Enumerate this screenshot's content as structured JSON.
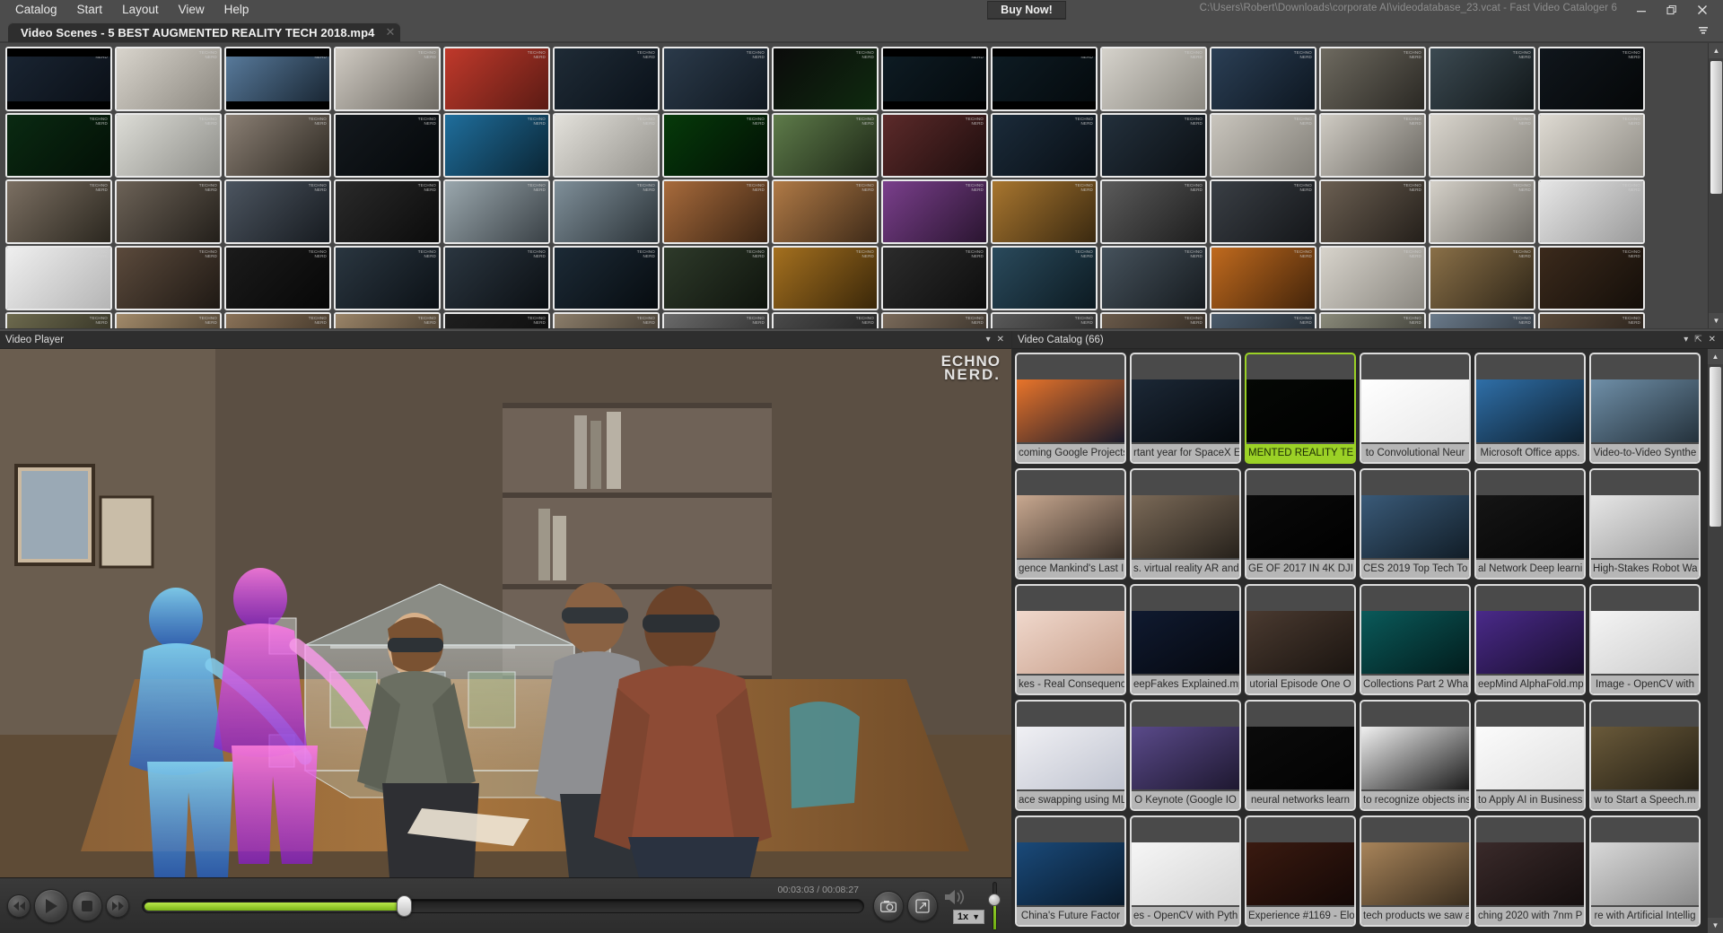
{
  "window": {
    "title_path": "C:\\Users\\Robert\\Downloads\\corporate AI\\videodatabase_23.vcat - Fast Video Cataloger 6",
    "minimize_label": "Minimize",
    "restore_label": "Restore",
    "close_label": "Close",
    "accent_color": "#9bd126",
    "chrome_color": "#4c4c4c"
  },
  "menu": {
    "items": [
      {
        "label": "Catalog"
      },
      {
        "label": "Start"
      },
      {
        "label": "Layout"
      },
      {
        "label": "View"
      },
      {
        "label": "Help"
      }
    ]
  },
  "buy_now": {
    "label": "Buy Now!"
  },
  "tabs": {
    "active": "Video Scenes - 5 BEST AUGMENTED REALITY TECH 2018.mp4",
    "close_label": "✕",
    "menu_label": "≡"
  },
  "scenes_panel": {
    "name": "Video Scenes",
    "scroll_up": "▲",
    "scroll_down": "▼",
    "watermark": "TECHNO\nNERD",
    "thumbs": [
      {
        "c1": "#1a2533",
        "c2": "#0a0f16",
        "bars": true
      },
      {
        "c1": "#d8d4cc",
        "c2": "#8c8880",
        "bars": false
      },
      {
        "c1": "#5b7ea0",
        "c2": "#16222e",
        "bars": true
      },
      {
        "c1": "#cfcac2",
        "c2": "#6e6a63",
        "bars": false
      },
      {
        "c1": "#c0392b",
        "c2": "#5b1b14",
        "bars": false
      },
      {
        "c1": "#1f2b36",
        "c2": "#0a1119",
        "bars": false
      },
      {
        "c1": "#2b3a4a",
        "c2": "#101820",
        "bars": false
      },
      {
        "c1": "#0b0b0b",
        "c2": "#0f2a0f",
        "bars": false
      },
      {
        "c1": "#0e1c24",
        "c2": "#04090c",
        "bars": true
      },
      {
        "c1": "#0e1c24",
        "c2": "#04090c",
        "bars": true
      },
      {
        "c1": "#d5d2cb",
        "c2": "#8b8880",
        "bars": false
      },
      {
        "c1": "#2b3f55",
        "c2": "#0d1620",
        "bars": false
      },
      {
        "c1": "#6e6a60",
        "c2": "#2a2823",
        "bars": false
      },
      {
        "c1": "#3c4a52",
        "c2": "#111719",
        "bars": false
      },
      {
        "c1": "#10161c",
        "c2": "#050708",
        "bars": false
      },
      {
        "c1": "#0a2a12",
        "c2": "#031006",
        "bars": false
      },
      {
        "c1": "#dcdcd6",
        "c2": "#8f8f8a",
        "bars": false
      },
      {
        "c1": "#8a7f74",
        "c2": "#2e2922",
        "bars": false
      },
      {
        "c1": "#14191e",
        "c2": "#05080a",
        "bars": false
      },
      {
        "c1": "#1f6e9c",
        "c2": "#0a2534",
        "bars": false
      },
      {
        "c1": "#e3e1db",
        "c2": "#95938d",
        "bars": false
      },
      {
        "c1": "#063a0a",
        "c2": "#021004",
        "bars": false
      },
      {
        "c1": "#5e7b4a",
        "c2": "#1d2716",
        "bars": false
      },
      {
        "c1": "#5c2a2a",
        "c2": "#1d0d0d",
        "bars": false
      },
      {
        "c1": "#1b2b3a",
        "c2": "#080e14",
        "bars": false
      },
      {
        "c1": "#23303c",
        "c2": "#0b0f13",
        "bars": false
      },
      {
        "c1": "#c9c5bd",
        "c2": "#827f78",
        "bars": false
      },
      {
        "c1": "#cfcbc3",
        "c2": "#6b6862",
        "bars": false
      },
      {
        "c1": "#d9d5cd",
        "c2": "#8b8881",
        "bars": false
      },
      {
        "c1": "#dedad2",
        "c2": "#918e87",
        "bars": false
      },
      {
        "c1": "#7b6f62",
        "c2": "#2b271f",
        "bars": false
      },
      {
        "c1": "#6c6257",
        "c2": "#231f1a",
        "bars": false
      },
      {
        "c1": "#4c5560",
        "c2": "#171b20",
        "bars": false
      },
      {
        "c1": "#2a2a2a",
        "c2": "#0b0b0b",
        "bars": false
      },
      {
        "c1": "#9aa7ad",
        "c2": "#3a4146",
        "bars": false
      },
      {
        "c1": "#7f8f99",
        "c2": "#2b3338",
        "bars": false
      },
      {
        "c1": "#a86b3c",
        "c2": "#3a2413",
        "bars": false
      },
      {
        "c1": "#b07a46",
        "c2": "#3e2a18",
        "bars": false
      },
      {
        "c1": "#7a3f8c",
        "c2": "#2a1530",
        "bars": false
      },
      {
        "c1": "#a8762f",
        "c2": "#3a2910",
        "bars": false
      },
      {
        "c1": "#5b5b5b",
        "c2": "#1d1d1d",
        "bars": false
      },
      {
        "c1": "#3a3f45",
        "c2": "#141619",
        "bars": false
      },
      {
        "c1": "#6b5f52",
        "c2": "#241f1a",
        "bars": false
      },
      {
        "c1": "#d4d0c8",
        "c2": "#6d6a64",
        "bars": false
      },
      {
        "c1": "#e6e6e6",
        "c2": "#9a9a9a",
        "bars": false
      },
      {
        "c1": "#efefef",
        "c2": "#b5b5b5",
        "bars": false
      },
      {
        "c1": "#5b4a3c",
        "c2": "#1f1914",
        "bars": false
      },
      {
        "c1": "#1b1b1b",
        "c2": "#070707",
        "bars": false
      },
      {
        "c1": "#2a3640",
        "c2": "#0c1116",
        "bars": false
      },
      {
        "c1": "#2b3640",
        "c2": "#0b0f13",
        "bars": false
      },
      {
        "c1": "#1c2a36",
        "c2": "#070c10",
        "bars": false
      },
      {
        "c1": "#2e3a2a",
        "c2": "#0f140d",
        "bars": false
      },
      {
        "c1": "#a4701f",
        "c2": "#3a2709",
        "bars": false
      },
      {
        "c1": "#2c2c2c",
        "c2": "#0d0d0d",
        "bars": false
      },
      {
        "c1": "#2a4a5c",
        "c2": "#0c1a21",
        "bars": false
      },
      {
        "c1": "#46525c",
        "c2": "#161b1f",
        "bars": false
      },
      {
        "c1": "#c06a1e",
        "c2": "#43240a",
        "bars": false
      },
      {
        "c1": "#d7d3cb",
        "c2": "#8b8881",
        "bars": false
      },
      {
        "c1": "#8a7048",
        "c2": "#2f2618",
        "bars": false
      },
      {
        "c1": "#3b2a1c",
        "c2": "#140e09",
        "bars": false
      },
      {
        "c1": "#6d6a4e",
        "c2": "#25241a",
        "bars": false
      },
      {
        "c1": "#a28a6a",
        "c2": "#372f24",
        "bars": false
      },
      {
        "c1": "#8a7258",
        "c2": "#2e261d",
        "bars": false
      },
      {
        "c1": "#9a8468",
        "c2": "#342c22",
        "bars": false
      },
      {
        "c1": "#1f1f1f",
        "c2": "#0a0a0a",
        "bars": false
      },
      {
        "c1": "#8b7d6a",
        "c2": "#2f2a23",
        "bars": false
      },
      {
        "c1": "#6a6a6a",
        "c2": "#232323",
        "bars": false
      },
      {
        "c1": "#4a4a4a",
        "c2": "#181818",
        "bars": false
      },
      {
        "c1": "#7a6a5a",
        "c2": "#29241e",
        "bars": false
      },
      {
        "c1": "#5a5a5a",
        "c2": "#1e1e1e",
        "bars": false
      },
      {
        "c1": "#6a5a4a",
        "c2": "#231e19",
        "bars": false
      },
      {
        "c1": "#4a5a6a",
        "c2": "#181e23",
        "bars": false
      },
      {
        "c1": "#8a8a7a",
        "c2": "#2e2e29",
        "bars": false
      },
      {
        "c1": "#6a7a8a",
        "c2": "#23282e",
        "bars": false
      },
      {
        "c1": "#5a4a3a",
        "c2": "#1e1814",
        "bars": false
      }
    ]
  },
  "player": {
    "panel_title": "Video Player",
    "collapse_label": "▾",
    "close_label": "✕",
    "watermark_top": "ECHNO",
    "watermark_bottom": "NERD.",
    "time_current": "00:03:03",
    "time_total": "00:08:27",
    "time_display": "00:03:03 / 00:08:27",
    "progress_percent": 36,
    "volume_percent": 62,
    "speed": "1x",
    "speed_caret": "▼",
    "controls": [
      {
        "name": "rewind-button",
        "label": "⏪"
      },
      {
        "name": "play-button",
        "label": "▶"
      },
      {
        "name": "stop-button",
        "label": "■"
      },
      {
        "name": "forward-button",
        "label": "⏩"
      }
    ],
    "snapshot_label": "Snapshot",
    "fullscreen_label": "Fullscreen",
    "mute_label": "Mute"
  },
  "catalog": {
    "panel_title": "Video Catalog (66)",
    "count": 66,
    "collapse_label": "▾",
    "pin_label": "⇱",
    "close_label": "✕",
    "scroll_up": "▲",
    "scroll_down": "▼",
    "items": [
      {
        "caption": "coming Google Projects",
        "selected": false,
        "c1": "#e8742a",
        "c2": "#1a1a2a"
      },
      {
        "caption": "rtant year for SpaceX E",
        "selected": false,
        "c1": "#1c2836",
        "c2": "#05090e"
      },
      {
        "caption": "MENTED REALITY TE",
        "selected": true,
        "c1": "#050805",
        "c2": "#000000"
      },
      {
        "caption": "to Convolutional Neur",
        "selected": false,
        "c1": "#ffffff",
        "c2": "#e8e8e8"
      },
      {
        "caption": "Microsoft Office apps.",
        "selected": false,
        "c1": "#2f6fa8",
        "c2": "#0d1f2e"
      },
      {
        "caption": "Video-to-Video Synthe",
        "selected": false,
        "c1": "#6f8fa8",
        "c2": "#24313b"
      },
      {
        "caption": "gence Mankind's Last I",
        "selected": false,
        "c1": "#c8a890",
        "c2": "#3a3028"
      },
      {
        "caption": "s. virtual reality AR and",
        "selected": false,
        "c1": "#7b6a58",
        "c2": "#26211b"
      },
      {
        "caption": "GE OF 2017 IN 4K DJI",
        "selected": false,
        "c1": "#0a0a0a",
        "c2": "#000000"
      },
      {
        "caption": "CES 2019 Top Tech To",
        "selected": false,
        "c1": "#3a5a78",
        "c2": "#111d27"
      },
      {
        "caption": "al Network Deep learni",
        "selected": false,
        "c1": "#151515",
        "c2": "#050505"
      },
      {
        "caption": "High-Stakes Robot Wa",
        "selected": false,
        "c1": "#e6e6e6",
        "c2": "#9a9a9a"
      },
      {
        "caption": "kes - Real Consequenc",
        "selected": false,
        "c1": "#f0d8cc",
        "c2": "#c8a08c"
      },
      {
        "caption": "eepFakes Explained.mp",
        "selected": false,
        "c1": "#101a30",
        "c2": "#05080f"
      },
      {
        "caption": "utorial Episode One O",
        "selected": false,
        "c1": "#4a3a30",
        "c2": "#1a1410"
      },
      {
        "caption": "Collections Part 2 Wha",
        "selected": false,
        "c1": "#0a5a5a",
        "c2": "#021c1c"
      },
      {
        "caption": "eepMind AlphaFold.mp",
        "selected": false,
        "c1": "#4a2a8a",
        "c2": "#190e2e"
      },
      {
        "caption": "Image - OpenCV with",
        "selected": false,
        "c1": "#f4f4f4",
        "c2": "#cccccc"
      },
      {
        "caption": "ace swapping using ML",
        "selected": false,
        "c1": "#f0f0f4",
        "c2": "#c0c4d0"
      },
      {
        "caption": "O Keynote (Google IO",
        "selected": false,
        "c1": "#5a4a8a",
        "c2": "#1e1830"
      },
      {
        "caption": "neural networks learn",
        "selected": false,
        "c1": "#0b0b0b",
        "c2": "#020202"
      },
      {
        "caption": "to recognize objects ins",
        "selected": false,
        "c1": "#f0f0f0",
        "c2": "#1a1a1a"
      },
      {
        "caption": "to Apply AI in Business",
        "selected": false,
        "c1": "#fbfbfb",
        "c2": "#e0e0e0"
      },
      {
        "caption": "w to Start a Speech.m",
        "selected": false,
        "c1": "#6a5a3a",
        "c2": "#241f14"
      },
      {
        "caption": "China's Future Factor",
        "selected": false,
        "c1": "#1a4a7a",
        "c2": "#08192a"
      },
      {
        "caption": "es - OpenCV with Pyth",
        "selected": false,
        "c1": "#f6f6f6",
        "c2": "#d4d4d4"
      },
      {
        "caption": "Experience #1169 - Elo",
        "selected": false,
        "c1": "#3a1a10",
        "c2": "#140806"
      },
      {
        "caption": "tech products we saw a",
        "selected": false,
        "c1": "#a8845a",
        "c2": "#3a2e1f"
      },
      {
        "caption": "ching 2020 with 7nm P",
        "selected": false,
        "c1": "#3a2a2a",
        "c2": "#140e0e"
      },
      {
        "caption": "re with Artificial Intellig",
        "selected": false,
        "c1": "#d8d8d8",
        "c2": "#8a8a8a"
      }
    ]
  }
}
